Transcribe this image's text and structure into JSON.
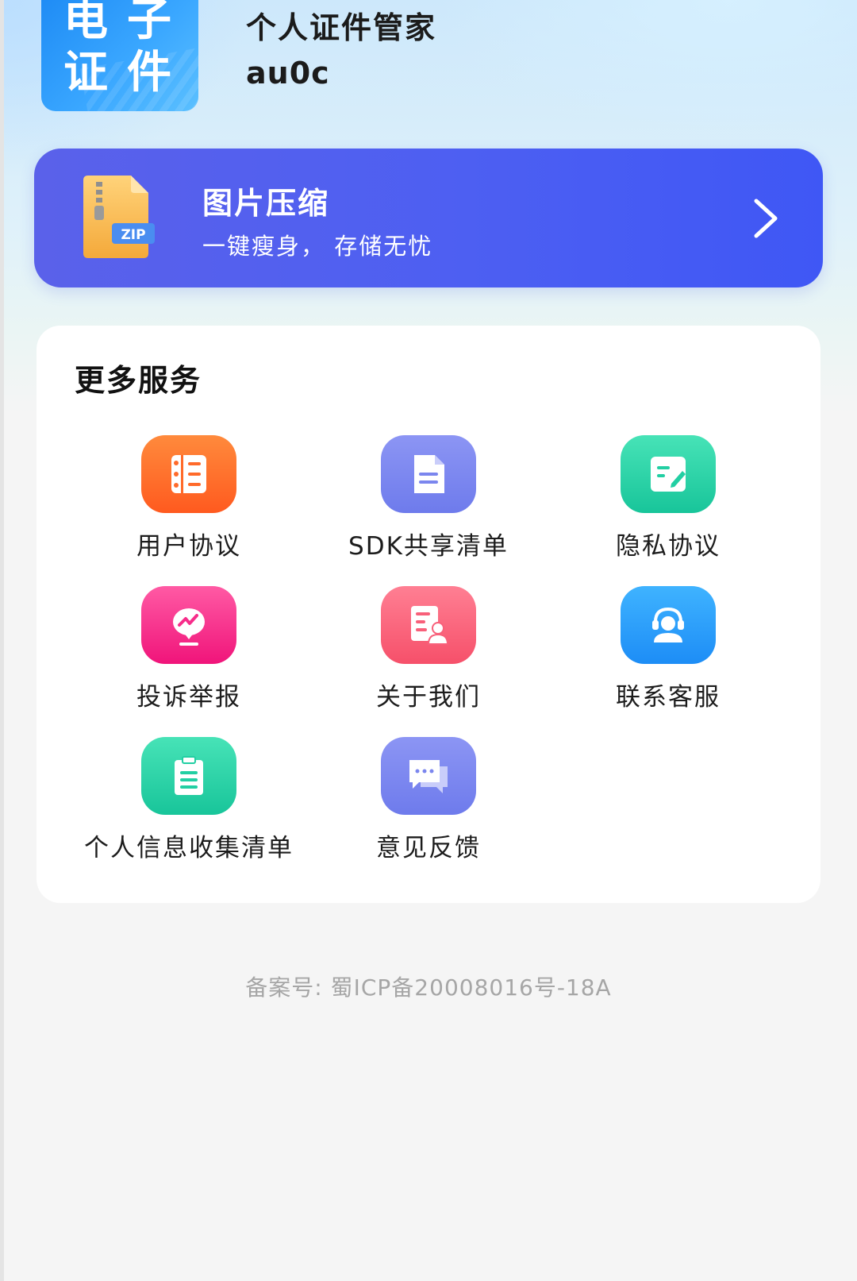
{
  "header": {
    "logo_line1": "电子",
    "logo_line2": "证件",
    "title": "个人证件管家",
    "user": "au0c"
  },
  "banner": {
    "icon": "zip-file-icon",
    "icon_text": "ZIP",
    "title": "图片压缩",
    "subtitle": "一键瘦身，  存储无忧",
    "chevron": "chevron-right-icon",
    "gradient": [
      "#5a61ea",
      "#3f57f5"
    ]
  },
  "services": {
    "title": "更多服务",
    "items": [
      {
        "label": "用户协议",
        "icon": "user-agreement-icon",
        "color": "#ff6a2a"
      },
      {
        "label": "SDK共享清单",
        "icon": "document-list-icon",
        "color": "#7b86ee"
      },
      {
        "label": "隐私协议",
        "icon": "privacy-edit-icon",
        "color": "#22cfa3"
      },
      {
        "label": "投诉举报",
        "icon": "complaint-chat-icon",
        "color": "#f72c8a"
      },
      {
        "label": "关于我们",
        "icon": "about-us-icon",
        "color": "#f8607a"
      },
      {
        "label": "联系客服",
        "icon": "customer-service-icon",
        "color": "#2a9ff9"
      },
      {
        "label": "个人信息收集清单",
        "icon": "clipboard-icon",
        "color": "#22cfa3"
      },
      {
        "label": "意见反馈",
        "icon": "feedback-chat-icon",
        "color": "#7b86ee"
      }
    ]
  },
  "footer": {
    "icp": "备案号:  蜀ICP备20008016号-18A"
  }
}
